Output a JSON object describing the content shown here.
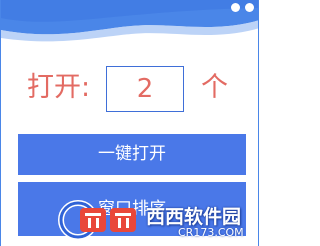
{
  "colors": {
    "accent": "#4a78e8",
    "header": "#4a86e8",
    "text_red": "#e36b63",
    "input_border": "#3f6fd8"
  },
  "header": {
    "icons": [
      "window-dot-icon",
      "window-dot-icon"
    ]
  },
  "count": {
    "label": "打开:",
    "value": "2",
    "unit": "个"
  },
  "buttons": {
    "open_all": "一键打开",
    "second": "窗口排序"
  },
  "watermark": {
    "brand": "西西软件园",
    "url": "CR173.COM"
  }
}
